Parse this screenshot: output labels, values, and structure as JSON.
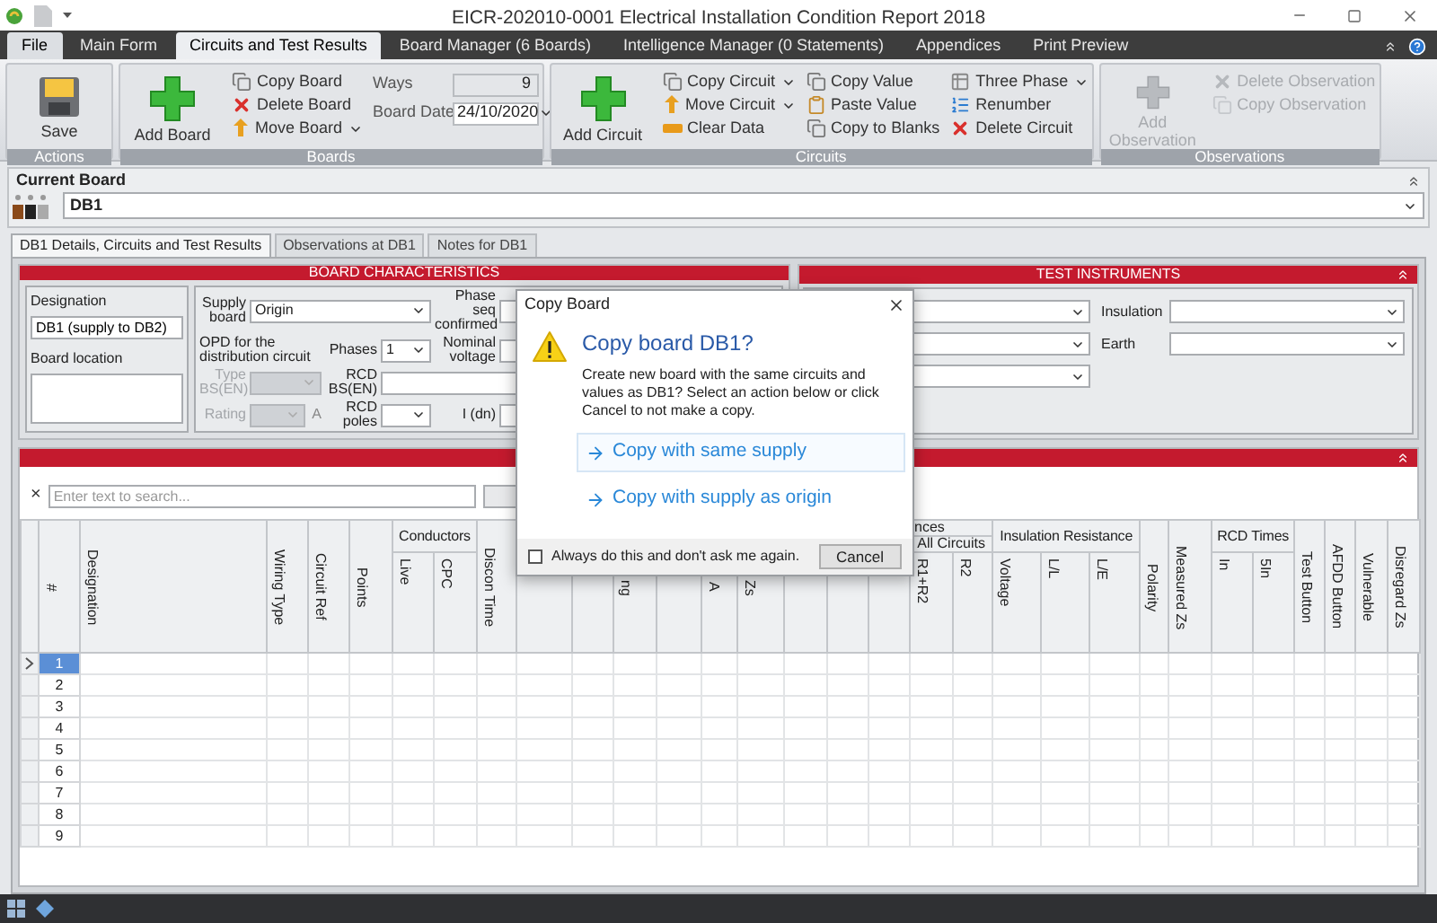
{
  "window": {
    "title": "EICR-202010-0001 Electrical Installation Condition Report 2018"
  },
  "tabs": [
    {
      "label": "File",
      "kind": "file",
      "selected": false
    },
    {
      "label": "Main Form",
      "kind": "tab",
      "selected": false
    },
    {
      "label": "Circuits and Test Results",
      "kind": "tab",
      "selected": true
    },
    {
      "label": "Board Manager (6 Boards)",
      "kind": "tab",
      "selected": false
    },
    {
      "label": "Intelligence Manager (0 Statements)",
      "kind": "tab",
      "selected": false
    },
    {
      "label": "Appendices",
      "kind": "tab",
      "selected": false
    },
    {
      "label": "Print Preview",
      "kind": "tab",
      "selected": false
    }
  ],
  "ribbon_groups": [
    {
      "label": "Actions",
      "columns": [
        [
          {
            "kind": "large",
            "label": "Save",
            "disabled": false
          }
        ]
      ]
    },
    {
      "label": "Boards",
      "columns": [
        [
          {
            "kind": "large",
            "label": "Add Board",
            "disabled": false
          }
        ],
        [
          {
            "kind": "small",
            "label": "Copy Board",
            "dropdown": false,
            "disabled": false
          },
          {
            "kind": "small",
            "label": "Delete Board",
            "dropdown": false,
            "disabled": false
          },
          {
            "kind": "small",
            "label": "Move Board",
            "dropdown": true,
            "disabled": false
          }
        ],
        [
          {
            "kind": "field",
            "label": "Ways",
            "value": "9"
          },
          {
            "kind": "date",
            "label": "Board Date",
            "value": "24/10/2020"
          }
        ]
      ]
    },
    {
      "label": "Circuits",
      "columns": [
        [
          {
            "kind": "large",
            "label": "Add Circuit",
            "disabled": false
          }
        ],
        [
          {
            "kind": "small",
            "label": "Copy Circuit",
            "dropdown": true,
            "disabled": false
          },
          {
            "kind": "small",
            "label": "Move Circuit",
            "dropdown": true,
            "disabled": false
          },
          {
            "kind": "small",
            "label": "Clear Data",
            "dropdown": false,
            "disabled": false
          }
        ],
        [
          {
            "kind": "small",
            "label": "Copy Value",
            "dropdown": false,
            "disabled": false
          },
          {
            "kind": "small",
            "label": "Paste Value",
            "dropdown": false,
            "disabled": false
          },
          {
            "kind": "small",
            "label": "Copy to Blanks",
            "dropdown": false,
            "disabled": false
          }
        ],
        [
          {
            "kind": "small",
            "label": "Three Phase",
            "dropdown": true,
            "disabled": false
          },
          {
            "kind": "small",
            "label": "Renumber",
            "dropdown": false,
            "disabled": false
          },
          {
            "kind": "small",
            "label": "Delete Circuit",
            "dropdown": false,
            "disabled": false
          }
        ]
      ]
    },
    {
      "label": "Observations",
      "columns": [
        [
          {
            "kind": "large",
            "label": "Add Observation",
            "disabled": true
          }
        ],
        [
          {
            "kind": "small",
            "label": "Delete Observation",
            "dropdown": false,
            "disabled": true
          },
          {
            "kind": "small",
            "label": "Copy Observation",
            "dropdown": false,
            "disabled": true
          }
        ]
      ]
    }
  ],
  "current_board": {
    "title": "Current Board",
    "value": "DB1"
  },
  "page_tabs": [
    {
      "label": "DB1 Details, Circuits and Test Results",
      "selected": true
    },
    {
      "label": "Observations at DB1",
      "selected": false
    },
    {
      "label": "Notes for DB1",
      "selected": false
    }
  ],
  "board_characteristics": {
    "title": "BOARD CHARACTERISTICS",
    "designation_label": "Designation",
    "designation": "DB1 (supply to DB2)",
    "location_label": "Board location",
    "fields": [
      {
        "label": "Supply board",
        "kind": "dropdown",
        "value": "Origin",
        "disabled": false
      },
      {
        "label": "Phase seq confirmed",
        "kind": "input",
        "disabled": false
      },
      {
        "label": "OPD for the distribution circuit",
        "kind": "heading"
      },
      {
        "label": "Phases",
        "kind": "dropdown",
        "value": "1",
        "disabled": false
      },
      {
        "label": "Nominal voltage",
        "kind": "input",
        "disabled": false
      },
      {
        "label": "Type BS(EN)",
        "kind": "dropdown",
        "disabled": true
      },
      {
        "label": "RCD BS(EN)",
        "kind": "input",
        "disabled": false
      },
      {
        "label": "Rating",
        "kind": "dropdown",
        "disabled": true,
        "unit": "A"
      },
      {
        "label": "RCD poles",
        "kind": "dropdown",
        "disabled": false
      },
      {
        "label": "I (dn)",
        "kind": "input",
        "disabled": false
      }
    ]
  },
  "test_instruments": {
    "title": "TEST INSTRUMENTS",
    "instruments": [
      {
        "kind": "dropdown"
      },
      {
        "kind": "dropdown"
      },
      {
        "kind": "dropdown"
      }
    ],
    "meters": [
      {
        "label": "Insulation",
        "kind": "dropdown"
      },
      {
        "label": "Earth",
        "kind": "dropdown"
      }
    ]
  },
  "circuits": {
    "clear": "×",
    "search_placeholder": "Enter text to search...",
    "column_groups": [
      {
        "columns": [
          {
            "label": "#"
          }
        ]
      },
      {
        "columns": [
          {
            "label": "Designation"
          }
        ]
      },
      {
        "columns": [
          {
            "label": "Wiring Type"
          }
        ]
      },
      {
        "columns": [
          {
            "label": "Circuit Ref"
          }
        ]
      },
      {
        "columns": [
          {
            "label": "Points"
          }
        ]
      },
      {
        "label": "Conductors",
        "columns": [
          {
            "label": "Live"
          },
          {
            "label": "CPC"
          }
        ]
      },
      {
        "columns": [
          {
            "label": "Discon Time"
          }
        ]
      },
      {
        "columns": [
          {
            "blank": true
          }
        ]
      },
      {
        "columns": [
          {
            "blank": true
          }
        ]
      },
      {
        "columns": [
          {
            "label": "ng"
          }
        ]
      },
      {
        "columns": [
          {
            "blank": true
          }
        ]
      },
      {
        "columns": [
          {
            "label": "A"
          }
        ]
      },
      {
        "columns": [
          {
            "label": "Zs"
          }
        ]
      },
      {
        "label": "nces",
        "subgroups": [
          {
            "columns": [
              {
                "blank": true
              },
              {
                "blank": true
              },
              {
                "blank": true
              }
            ]
          },
          {
            "label": "All Circuits",
            "columns": [
              {
                "label": "R1+R2"
              },
              {
                "label": "R2"
              }
            ]
          }
        ]
      },
      {
        "label": "Insulation Resistance",
        "columns": [
          {
            "label": "Voltage"
          },
          {
            "label": "L/L"
          },
          {
            "label": "L/E"
          }
        ]
      },
      {
        "columns": [
          {
            "label": "Polarity"
          }
        ]
      },
      {
        "columns": [
          {
            "label": "Measured Zs"
          }
        ]
      },
      {
        "label": "RCD Times",
        "columns": [
          {
            "label": "In"
          },
          {
            "label": "5In"
          }
        ]
      },
      {
        "columns": [
          {
            "label": "Test Button"
          }
        ]
      },
      {
        "columns": [
          {
            "label": "AFDD Button"
          }
        ]
      },
      {
        "columns": [
          {
            "label": "Vulnerable"
          }
        ]
      },
      {
        "columns": [
          {
            "label": "Disregard Zs"
          }
        ]
      }
    ],
    "rows": [
      {
        "number": "1",
        "selected": true
      },
      {
        "number": "2",
        "selected": false
      },
      {
        "number": "3",
        "selected": false
      },
      {
        "number": "4",
        "selected": false
      },
      {
        "number": "5",
        "selected": false
      },
      {
        "number": "6",
        "selected": false
      },
      {
        "number": "7",
        "selected": false
      },
      {
        "number": "8",
        "selected": false
      },
      {
        "number": "9",
        "selected": false
      }
    ]
  },
  "dialog": {
    "title": "Copy Board",
    "heading": "Copy board DB1?",
    "message": "Create new board with the same circuits and values as DB1?  Select an action below or click Cancel to not make a copy.",
    "options": [
      {
        "label": "Copy with same supply",
        "selected": true
      },
      {
        "label": "Copy with supply as origin",
        "selected": false
      }
    ],
    "remember": {
      "label": "Always do this and don't ask me again.",
      "checked": false
    },
    "cancel": "Cancel"
  }
}
